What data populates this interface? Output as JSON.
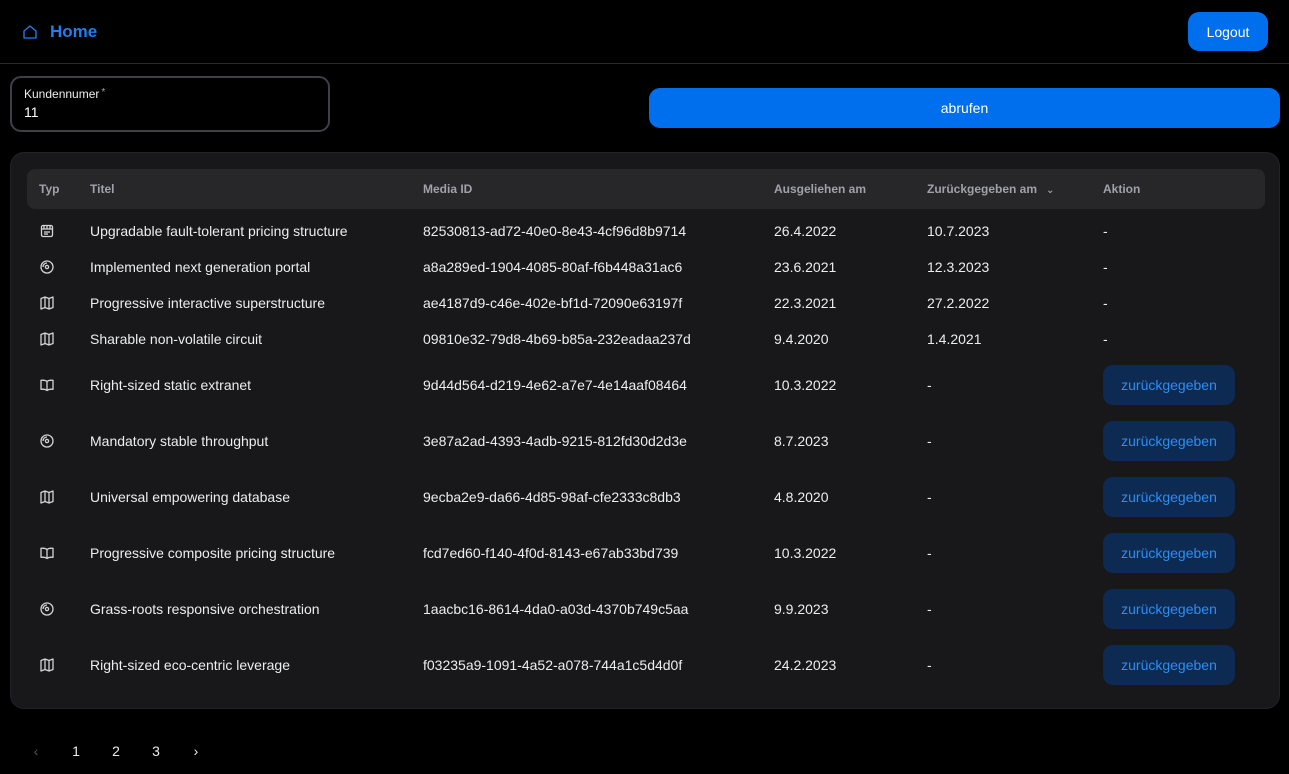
{
  "header": {
    "home_label": "Home",
    "logout_label": "Logout"
  },
  "form": {
    "label": "Kundennumer",
    "required_mark": "*",
    "value": "11",
    "fetch_label": "abrufen"
  },
  "table": {
    "columns": [
      "Typ",
      "Titel",
      "Media ID",
      "Ausgeliehen am",
      "Zurückgegeben am",
      "Aktion"
    ],
    "sort_icon": "chevron-down-icon",
    "rows": [
      {
        "type": "film",
        "title": "Upgradable fault-tolerant pricing structure",
        "media_id": "82530813-ad72-40e0-8e43-4cf96d8b9714",
        "lent": "26.4.2022",
        "returned": "10.7.2023",
        "action": "-"
      },
      {
        "type": "disc",
        "title": "Implemented next generation portal",
        "media_id": "a8a289ed-1904-4085-80af-f6b448a31ac6",
        "lent": "23.6.2021",
        "returned": "12.3.2023",
        "action": "-"
      },
      {
        "type": "map",
        "title": "Progressive interactive superstructure",
        "media_id": "ae4187d9-c46e-402e-bf1d-72090e63197f",
        "lent": "22.3.2021",
        "returned": "27.2.2022",
        "action": "-"
      },
      {
        "type": "map",
        "title": "Sharable non-volatile circuit",
        "media_id": "09810e32-79d8-4b69-b85a-232eadaa237d",
        "lent": "9.4.2020",
        "returned": "1.4.2021",
        "action": "-"
      },
      {
        "type": "book",
        "title": "Right-sized static extranet",
        "media_id": "9d44d564-d219-4e62-a7e7-4e14aaf08464",
        "lent": "10.3.2022",
        "returned": "-",
        "action": "zurückgegeben"
      },
      {
        "type": "disc",
        "title": "Mandatory stable throughput",
        "media_id": "3e87a2ad-4393-4adb-9215-812fd30d2d3e",
        "lent": "8.7.2023",
        "returned": "-",
        "action": "zurückgegeben"
      },
      {
        "type": "map",
        "title": "Universal empowering database",
        "media_id": "9ecba2e9-da66-4d85-98af-cfe2333c8db3",
        "lent": "4.8.2020",
        "returned": "-",
        "action": "zurückgegeben"
      },
      {
        "type": "book",
        "title": "Progressive composite pricing structure",
        "media_id": "fcd7ed60-f140-4f0d-8143-e67ab33bd739",
        "lent": "10.3.2022",
        "returned": "-",
        "action": "zurückgegeben"
      },
      {
        "type": "disc",
        "title": "Grass-roots responsive orchestration",
        "media_id": "1aacbc16-8614-4da0-a03d-4370b749c5aa",
        "lent": "9.9.2023",
        "returned": "-",
        "action": "zurückgegeben"
      },
      {
        "type": "map",
        "title": "Right-sized eco-centric leverage",
        "media_id": "f03235a9-1091-4a52-a078-744a1c5d4d0f",
        "lent": "24.2.2023",
        "returned": "-",
        "action": "zurückgegeben"
      }
    ]
  },
  "pagination": {
    "prev_icon": "chevron-left-icon",
    "next_icon": "chevron-right-icon",
    "pages": [
      "1",
      "2",
      "3"
    ]
  },
  "colors": {
    "accent": "#006FEE",
    "background": "#000000",
    "card": "#18181b"
  }
}
